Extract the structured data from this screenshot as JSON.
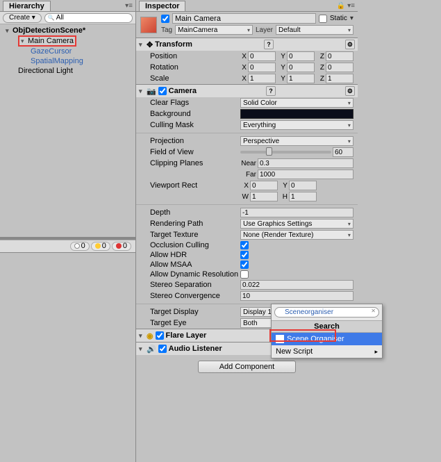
{
  "hierarchy": {
    "tab": "Hierarchy",
    "create_btn": "Create ▾",
    "search_placeholder": "All",
    "root": "ObjDetectionScene*",
    "items": [
      "Main Camera",
      "GazeCursor",
      "SpatialMapping",
      "Directional Light"
    ]
  },
  "status": {
    "c0": "0",
    "c1": "0",
    "c2": "0"
  },
  "inspector": {
    "tab": "Inspector",
    "name": "Main Camera",
    "static_label": "Static",
    "tag_label": "Tag",
    "tag_value": "MainCamera",
    "layer_label": "Layer",
    "layer_value": "Default"
  },
  "transform": {
    "title": "Transform",
    "position": "Position",
    "rotation": "Rotation",
    "scale": "Scale",
    "px": "0",
    "py": "0",
    "pz": "0",
    "rx": "0",
    "ry": "0",
    "rz": "0",
    "sx": "1",
    "sy": "1",
    "sz": "1"
  },
  "camera": {
    "title": "Camera",
    "clear_flags": "Clear Flags",
    "clear_flags_v": "Solid Color",
    "background": "Background",
    "culling": "Culling Mask",
    "culling_v": "Everything",
    "projection": "Projection",
    "projection_v": "Perspective",
    "fov": "Field of View",
    "fov_v": "60",
    "clipping": "Clipping Planes",
    "near": "Near",
    "near_v": "0.3",
    "far": "Far",
    "far_v": "1000",
    "viewport": "Viewport Rect",
    "vx": "0",
    "vy": "0",
    "vw": "1",
    "vh": "1",
    "depth": "Depth",
    "depth_v": "-1",
    "rendering": "Rendering Path",
    "rendering_v": "Use Graphics Settings",
    "target_tex": "Target Texture",
    "target_tex_v": "None (Render Texture)",
    "occlusion": "Occlusion Culling",
    "hdr": "Allow HDR",
    "msaa": "Allow MSAA",
    "dyn_res": "Allow Dynamic Resolution",
    "stereo_sep": "Stereo Separation",
    "stereo_sep_v": "0.022",
    "stereo_conv": "Stereo Convergence",
    "stereo_conv_v": "10",
    "target_disp": "Target Display",
    "target_disp_v": "Display 1",
    "target_eye": "Target Eye",
    "target_eye_v": "Both"
  },
  "flare": {
    "title": "Flare Layer"
  },
  "audio": {
    "title": "Audio Listener"
  },
  "add_component": {
    "button": "Add Component",
    "search_value": "Sceneorganiser",
    "category": "Search",
    "result": "Scene Organiser",
    "new_script": "New Script"
  }
}
